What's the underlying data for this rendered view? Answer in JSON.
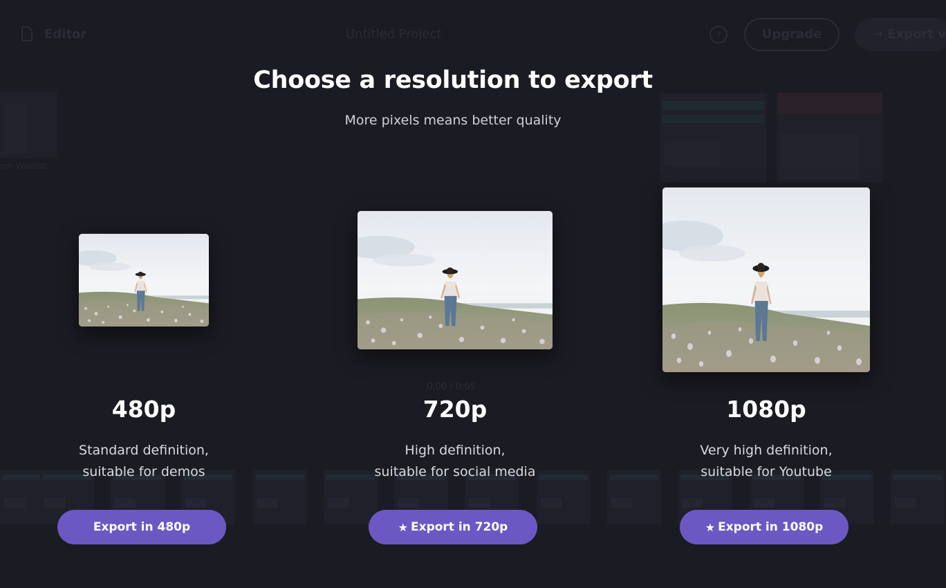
{
  "background": {
    "editor_label": "Editor",
    "project_title": "Untitled Project",
    "help_symbol": "?",
    "upgrade_label": "Upgrade",
    "export_label": "Export v",
    "ghost_text": "om Waitlist",
    "time_readout": "0:00 / 0:05"
  },
  "dialog": {
    "title": "Choose a resolution to export",
    "subtitle": "More pixels means better quality",
    "options": [
      {
        "resolution": "480p",
        "desc_line1": "Standard definition,",
        "desc_line2": "suitable for demos",
        "button_label": "Export in 480p",
        "starred": false
      },
      {
        "resolution": "720p",
        "desc_line1": "High definition,",
        "desc_line2": "suitable for social media",
        "button_label": "Export in 720p",
        "starred": true
      },
      {
        "resolution": "1080p",
        "desc_line1": "Very high definition,",
        "desc_line2": "suitable for Youtube",
        "button_label": "Export in 1080p",
        "starred": true
      }
    ]
  },
  "colors": {
    "background": "#1b1b23",
    "button": "#6b58c3",
    "text_primary": "#ffffff",
    "text_secondary": "#cfd0d8"
  },
  "icons": {
    "star": "star-icon",
    "document": "document-icon",
    "help": "help-icon",
    "export": "arrow-right-icon"
  }
}
